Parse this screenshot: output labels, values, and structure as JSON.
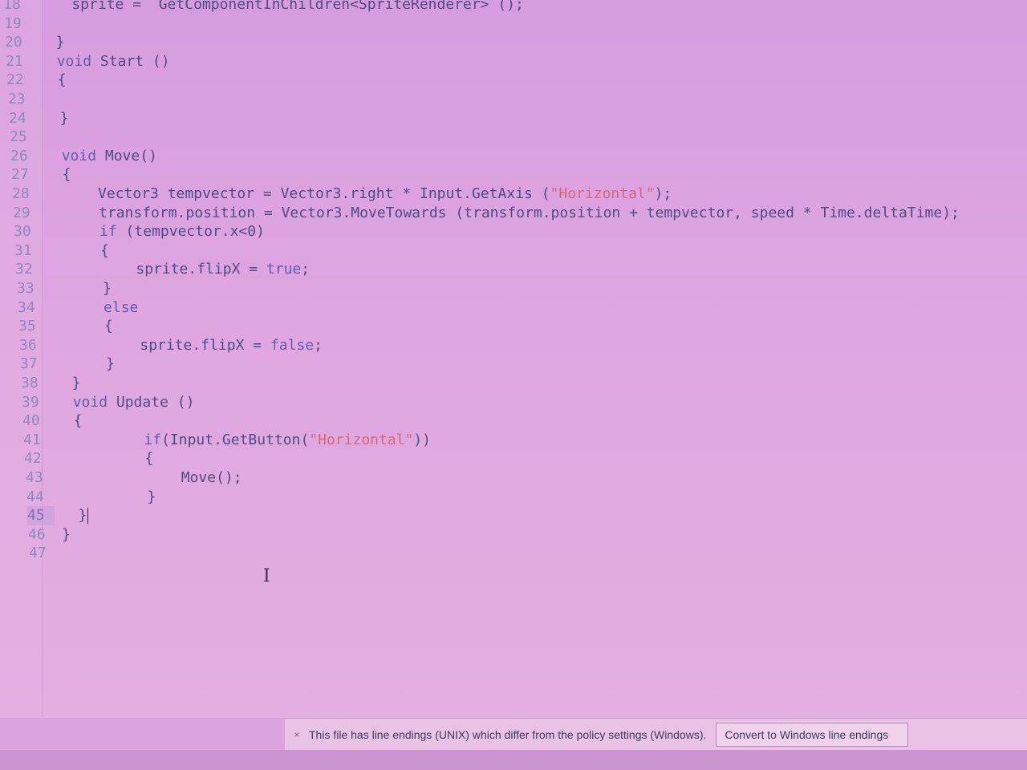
{
  "editor": {
    "lines": [
      {
        "no": "18",
        "text": "    sprite =  GetComponentInChildren<SpriteRenderer> ();"
      },
      {
        "no": "19",
        "text": ""
      },
      {
        "no": "20",
        "text": "  }"
      },
      {
        "no": "21",
        "text": "  void Start ()"
      },
      {
        "no": "22",
        "text": "  {"
      },
      {
        "no": "23",
        "text": ""
      },
      {
        "no": "24",
        "text": "  }"
      },
      {
        "no": "25",
        "text": ""
      },
      {
        "no": "26",
        "text": "  void Move()"
      },
      {
        "no": "27",
        "text": "  {"
      },
      {
        "no": "28",
        "text": "      Vector3 tempvector = Vector3.right * Input.GetAxis (\"Horizontal\");"
      },
      {
        "no": "29",
        "text": "      transform.position = Vector3.MoveTowards (transform.position + tempvector, speed * Time.deltaTime);"
      },
      {
        "no": "30",
        "text": "      if (tempvector.x<0)"
      },
      {
        "no": "31",
        "text": "      {"
      },
      {
        "no": "32",
        "text": "          sprite.flipX = true;"
      },
      {
        "no": "33",
        "text": "      }"
      },
      {
        "no": "34",
        "text": "      else"
      },
      {
        "no": "35",
        "text": "      {"
      },
      {
        "no": "36",
        "text": "          sprite.flipX = false;"
      },
      {
        "no": "37",
        "text": "      }"
      },
      {
        "no": "38",
        "text": "  }"
      },
      {
        "no": "39",
        "text": "  void Update ()"
      },
      {
        "no": "40",
        "text": "  {"
      },
      {
        "no": "41",
        "text": "          if(Input.GetButton(\"Horizontal\"))"
      },
      {
        "no": "42",
        "text": "          {"
      },
      {
        "no": "43",
        "text": "              Move();"
      },
      {
        "no": "44",
        "text": "          }"
      },
      {
        "no": "45",
        "text": "  }"
      },
      {
        "no": "46",
        "text": "}"
      },
      {
        "no": "47",
        "text": ""
      }
    ],
    "current_line": "45"
  },
  "infobar": {
    "close_glyph": "×",
    "message": "This file has line endings (UNIX) which differ from the policy settings (Windows).",
    "action_label": "Convert to Windows line endings"
  }
}
